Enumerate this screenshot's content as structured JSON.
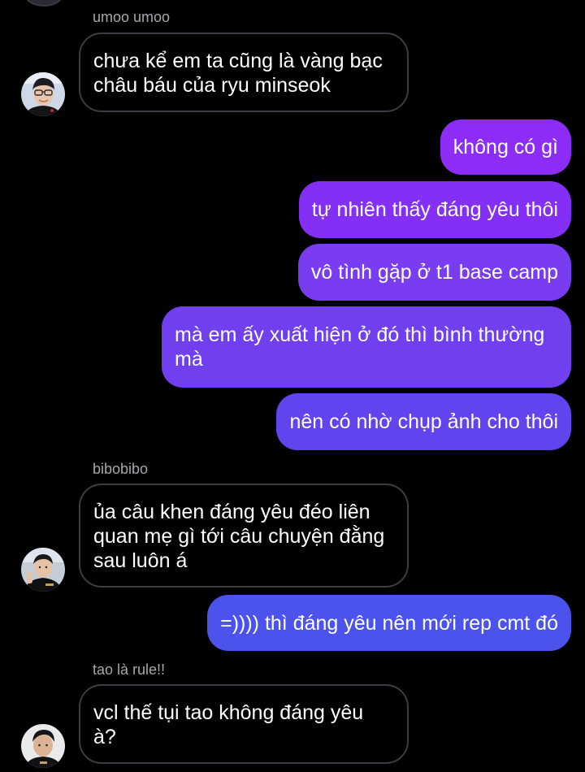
{
  "colors": {
    "background": "#000000",
    "incoming_border": "#3c3c44",
    "sender_name": "#a6a6ad",
    "outgoing_violet": "#8d2cf7",
    "outgoing_purple": "#7a3cf0",
    "outgoing_indigo": "#5f46ee",
    "outgoing_blue": "#4b53ec"
  },
  "messages": [
    {
      "sender": "umoo umoo",
      "text": "chưa kể em ta cũng là vàng bạc châu báu của ryu minseok",
      "direction": "incoming",
      "avatar": "avatar-icon"
    },
    {
      "text": "không có gì",
      "direction": "outgoing"
    },
    {
      "text": "tự nhiên thấy đáng yêu thôi",
      "direction": "outgoing"
    },
    {
      "text": "vô tình gặp ở t1 base camp",
      "direction": "outgoing"
    },
    {
      "text": "mà em ấy xuất hiện ở đó thì bình thường mà",
      "direction": "outgoing"
    },
    {
      "text": "nên có nhờ chụp ảnh cho thôi",
      "direction": "outgoing"
    },
    {
      "sender": "bibobibo",
      "text": "ủa câu khen đáng yêu đéo liên quan mẹ gì tới câu chuyện đằng sau luôn á",
      "direction": "incoming",
      "avatar": "avatar-icon"
    },
    {
      "text": "=)))) thì đáng yêu nên mới rep cmt đó",
      "direction": "outgoing"
    },
    {
      "sender": "tao là rule!!",
      "text": "vcl thế tụi tao không đáng yêu à?",
      "direction": "incoming",
      "avatar": "avatar-icon"
    }
  ]
}
